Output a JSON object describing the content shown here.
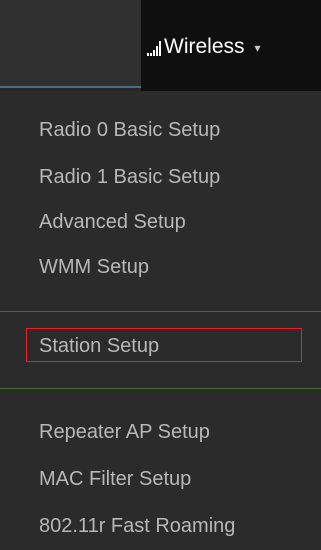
{
  "navbar": {
    "wireless_label": "Wireless",
    "signal_icon": "signal-bars-icon",
    "caret_icon": "caret-down-icon",
    "caret_glyph": "▾"
  },
  "menu": {
    "items": [
      {
        "label": "Radio 0 Basic Setup"
      },
      {
        "label": "Radio 1 Basic Setup"
      },
      {
        "label": "Advanced Setup"
      },
      {
        "label": "WMM Setup"
      },
      {
        "label": "Station Setup",
        "highlighted": true
      },
      {
        "label": "Repeater AP Setup"
      },
      {
        "label": "MAC Filter Setup"
      },
      {
        "label": "802.11r Fast Roaming"
      }
    ]
  },
  "colors": {
    "menu_background": "#2b2b2b",
    "menu_text": "#b8b8b8",
    "navbar_text": "#ffffff",
    "divider": "#3f6f2a",
    "highlight_border": "#e0232c",
    "underline_accent": "#4a6c8e"
  }
}
